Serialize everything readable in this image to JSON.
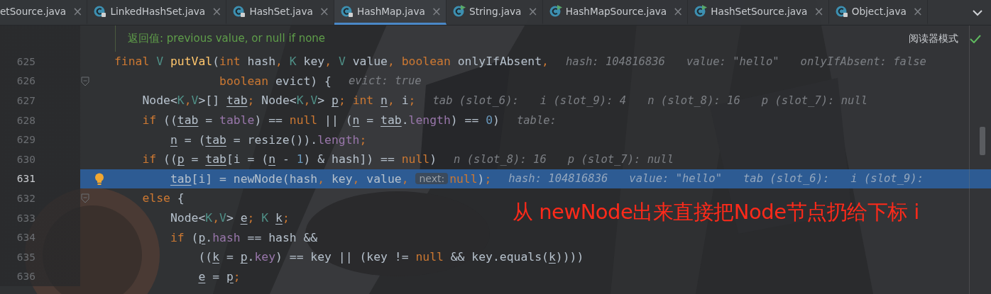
{
  "tabs": [
    {
      "label": "etSource.java",
      "kind": "plain",
      "selected": false
    },
    {
      "label": "LinkedHashSet.java",
      "kind": "locked",
      "selected": false
    },
    {
      "label": "HashSet.java",
      "kind": "locked",
      "selected": false
    },
    {
      "label": "HashMap.java",
      "kind": "locked",
      "selected": true
    },
    {
      "label": "String.java",
      "kind": "runnable",
      "selected": false
    },
    {
      "label": "HashMapSource.java",
      "kind": "runnable",
      "selected": false
    },
    {
      "label": "HashSetSource.java",
      "kind": "runnable",
      "selected": false
    },
    {
      "label": "Object.java",
      "kind": "locked",
      "selected": false
    }
  ],
  "close_glyph": "×",
  "doc_hint": "返回值: previous value, or null if none",
  "reader_mode": "阅读器模式",
  "lines": [
    {
      "number": "625",
      "current": false,
      "fold": false,
      "bulb": false,
      "tokens": [
        {
          "kind": "kw",
          "text": "final "
        },
        {
          "kind": "type",
          "text": "V "
        },
        {
          "kind": "fn",
          "text": "putVal"
        },
        {
          "kind": "plain",
          "text": "("
        },
        {
          "kind": "kw",
          "text": "int "
        },
        {
          "kind": "plain",
          "text": "hash"
        },
        {
          "kind": "kw",
          "text": ", "
        },
        {
          "kind": "type",
          "text": "K "
        },
        {
          "kind": "plain",
          "text": "key"
        },
        {
          "kind": "kw",
          "text": ", "
        },
        {
          "kind": "type",
          "text": "V "
        },
        {
          "kind": "plain",
          "text": "value"
        },
        {
          "kind": "kw",
          "text": ", boolean "
        },
        {
          "kind": "plain",
          "text": "onlyIfAbsent"
        },
        {
          "kind": "kw",
          "text": ","
        }
      ],
      "hints": [
        "hash: 104816836",
        "value: \"hello\"",
        "onlyIfAbsent: false"
      ]
    },
    {
      "number": "626",
      "current": false,
      "fold": true,
      "bulb": false,
      "tokens": [
        {
          "kind": "kw",
          "text": "               boolean "
        },
        {
          "kind": "plain",
          "text": "evict) {"
        }
      ],
      "hints": [
        "evict: true"
      ]
    },
    {
      "number": "627",
      "current": false,
      "fold": false,
      "bulb": false,
      "tokens": [
        {
          "kind": "plain",
          "text": "    Node<"
        },
        {
          "kind": "type",
          "text": "K"
        },
        {
          "kind": "kw",
          "text": ","
        },
        {
          "kind": "type",
          "text": "V"
        },
        {
          "kind": "plain",
          "text": ">[] "
        },
        {
          "kind": "var",
          "text": "tab"
        },
        {
          "kind": "kw",
          "text": "; "
        },
        {
          "kind": "plain",
          "text": "Node<"
        },
        {
          "kind": "type",
          "text": "K"
        },
        {
          "kind": "kw",
          "text": ","
        },
        {
          "kind": "type",
          "text": "V"
        },
        {
          "kind": "plain",
          "text": "> "
        },
        {
          "kind": "var",
          "text": "p"
        },
        {
          "kind": "kw",
          "text": "; int "
        },
        {
          "kind": "var",
          "text": "n"
        },
        {
          "kind": "kw",
          "text": ", "
        },
        {
          "kind": "plain",
          "text": "i"
        },
        {
          "kind": "kw",
          "text": ";"
        }
      ],
      "hints": [
        "tab (slot_6):",
        "i (slot_9): 4",
        "n (slot_8): 16",
        "p (slot_7): null"
      ]
    },
    {
      "number": "628",
      "current": false,
      "fold": false,
      "bulb": false,
      "tokens": [
        {
          "kind": "kw",
          "text": "    if "
        },
        {
          "kind": "plain",
          "text": "(("
        },
        {
          "kind": "var",
          "text": "tab"
        },
        {
          "kind": "plain",
          "text": " = "
        },
        {
          "kind": "field",
          "text": "table"
        },
        {
          "kind": "plain",
          "text": ") == "
        },
        {
          "kind": "kw",
          "text": "null "
        },
        {
          "kind": "plain",
          "text": "|| ("
        },
        {
          "kind": "var",
          "text": "n"
        },
        {
          "kind": "plain",
          "text": " = "
        },
        {
          "kind": "var",
          "text": "tab"
        },
        {
          "kind": "plain",
          "text": "."
        },
        {
          "kind": "field",
          "text": "length"
        },
        {
          "kind": "plain",
          "text": ") == "
        },
        {
          "kind": "num",
          "text": "0"
        },
        {
          "kind": "plain",
          "text": ")"
        }
      ],
      "hints": [
        "table:"
      ]
    },
    {
      "number": "629",
      "current": false,
      "fold": false,
      "bulb": false,
      "tokens": [
        {
          "kind": "var",
          "text": "        n"
        },
        {
          "kind": "plain",
          "text": " = ("
        },
        {
          "kind": "var",
          "text": "tab"
        },
        {
          "kind": "plain",
          "text": " = resize())."
        },
        {
          "kind": "field",
          "text": "length"
        },
        {
          "kind": "kw",
          "text": ";"
        }
      ]
    },
    {
      "number": "630",
      "current": false,
      "fold": false,
      "bulb": false,
      "tokens": [
        {
          "kind": "kw",
          "text": "    if "
        },
        {
          "kind": "plain",
          "text": "(("
        },
        {
          "kind": "var",
          "text": "p"
        },
        {
          "kind": "plain",
          "text": " = "
        },
        {
          "kind": "var",
          "text": "tab"
        },
        {
          "kind": "plain",
          "text": "[i = ("
        },
        {
          "kind": "var",
          "text": "n"
        },
        {
          "kind": "plain",
          "text": " - "
        },
        {
          "kind": "num",
          "text": "1"
        },
        {
          "kind": "plain",
          "text": ") & hash]) == "
        },
        {
          "kind": "kw",
          "text": "null"
        },
        {
          "kind": "plain",
          "text": ")"
        }
      ],
      "hints": [
        "n (slot_8): 16",
        "p (slot_7): null"
      ]
    },
    {
      "number": "631",
      "current": true,
      "fold": false,
      "bulb": true,
      "tokens": [
        {
          "kind": "var",
          "text": "        tab"
        },
        {
          "kind": "plain",
          "text": "[i] = newNode(hash"
        },
        {
          "kind": "kw",
          "text": ", "
        },
        {
          "kind": "plain",
          "text": "key"
        },
        {
          "kind": "kw",
          "text": ", "
        },
        {
          "kind": "plain",
          "text": "value"
        },
        {
          "kind": "kw",
          "text": ", "
        },
        {
          "kind": "param",
          "text": "next:"
        },
        {
          "kind": "kw",
          "text": "null"
        },
        {
          "kind": "plain",
          "text": ")"
        },
        {
          "kind": "kw",
          "text": ";"
        }
      ],
      "hints": [
        "hash: 104816836",
        "value: \"hello\"",
        "tab (slot_6):",
        "i (slot_9):"
      ]
    },
    {
      "number": "632",
      "current": false,
      "fold": true,
      "bulb": false,
      "tokens": [
        {
          "kind": "kw",
          "text": "    else "
        },
        {
          "kind": "plain",
          "text": "{"
        }
      ]
    },
    {
      "number": "633",
      "current": false,
      "fold": false,
      "bulb": false,
      "tokens": [
        {
          "kind": "plain",
          "text": "        Node<"
        },
        {
          "kind": "type",
          "text": "K"
        },
        {
          "kind": "kw",
          "text": ","
        },
        {
          "kind": "type",
          "text": "V"
        },
        {
          "kind": "plain",
          "text": "> "
        },
        {
          "kind": "var",
          "text": "e"
        },
        {
          "kind": "kw",
          "text": "; "
        },
        {
          "kind": "type",
          "text": "K "
        },
        {
          "kind": "var",
          "text": "k"
        },
        {
          "kind": "kw",
          "text": ";"
        }
      ]
    },
    {
      "number": "634",
      "current": false,
      "fold": false,
      "bulb": false,
      "tokens": [
        {
          "kind": "kw",
          "text": "        if "
        },
        {
          "kind": "plain",
          "text": "("
        },
        {
          "kind": "var",
          "text": "p"
        },
        {
          "kind": "plain",
          "text": "."
        },
        {
          "kind": "field",
          "text": "hash"
        },
        {
          "kind": "plain",
          "text": " == hash &&"
        }
      ]
    },
    {
      "number": "635",
      "current": false,
      "fold": false,
      "bulb": false,
      "tokens": [
        {
          "kind": "plain",
          "text": "            (("
        },
        {
          "kind": "var",
          "text": "k"
        },
        {
          "kind": "plain",
          "text": " = "
        },
        {
          "kind": "var",
          "text": "p"
        },
        {
          "kind": "plain",
          "text": "."
        },
        {
          "kind": "field",
          "text": "key"
        },
        {
          "kind": "plain",
          "text": ") == key || (key != "
        },
        {
          "kind": "kw",
          "text": "null "
        },
        {
          "kind": "plain",
          "text": "&& key.equals("
        },
        {
          "kind": "var",
          "text": "k"
        },
        {
          "kind": "plain",
          "text": "))))"
        }
      ]
    },
    {
      "number": "636",
      "current": false,
      "fold": false,
      "bulb": false,
      "tokens": [
        {
          "kind": "var",
          "text": "            e"
        },
        {
          "kind": "plain",
          "text": " = "
        },
        {
          "kind": "var",
          "text": "p"
        },
        {
          "kind": "kw",
          "text": ";"
        }
      ]
    }
  ],
  "annotation": "从 newNode出来直接把Node节点扔给下标 i"
}
